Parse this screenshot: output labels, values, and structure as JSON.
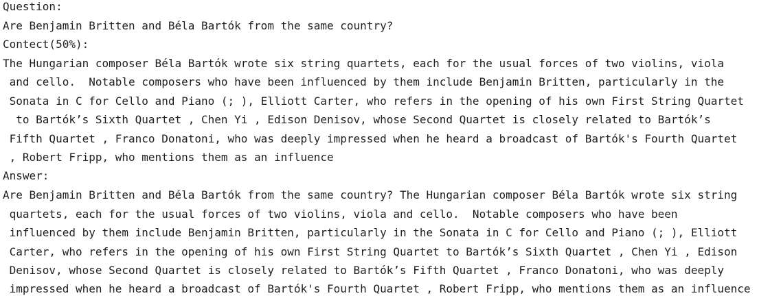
{
  "question": {
    "label": "Question:",
    "text": "Are Benjamin Britten and Béla Bartók from the same country?"
  },
  "context": {
    "label": "Contect(50%):",
    "lines": [
      "The Hungarian composer Béla Bartók wrote six string quartets, each for the usual forces of two violins, viola",
      " and cello.  Notable composers who have been influenced by them include Benjamin Britten, particularly in the",
      " Sonata in C for Cello and Piano (; ), Elliott Carter, who refers in the opening of his own First String Quartet",
      "  to Bartók’s Sixth Quartet , Chen Yi , Edison Denisov, whose Second Quartet is closely related to Bartók’s",
      " Fifth Quartet , Franco Donatoni, who was deeply impressed when he heard a broadcast of Bartók's Fourth Quartet",
      " , Robert Fripp, who mentions them as an influence"
    ]
  },
  "answer": {
    "label": "Answer:",
    "lines": [
      "Are Benjamin Britten and Béla Bartók from the same country? The Hungarian composer Béla Bartók wrote six string",
      " quartets, each for the usual forces of two violins, viola and cello.  Notable composers who have been",
      " influenced by them include Benjamin Britten, particularly in the Sonata in C for Cello and Piano (; ), Elliott",
      " Carter, who refers in the opening of his own First String Quartet to Bartók’s Sixth Quartet , Chen Yi , Edison",
      " Denisov, whose Second Quartet is closely related to Bartók’s Fifth Quartet , Franco Donatoni, who was deeply",
      " impressed when he heard a broadcast of Bartók's Fourth Quartet , Robert Fripp, who mentions them as an influence"
    ]
  }
}
